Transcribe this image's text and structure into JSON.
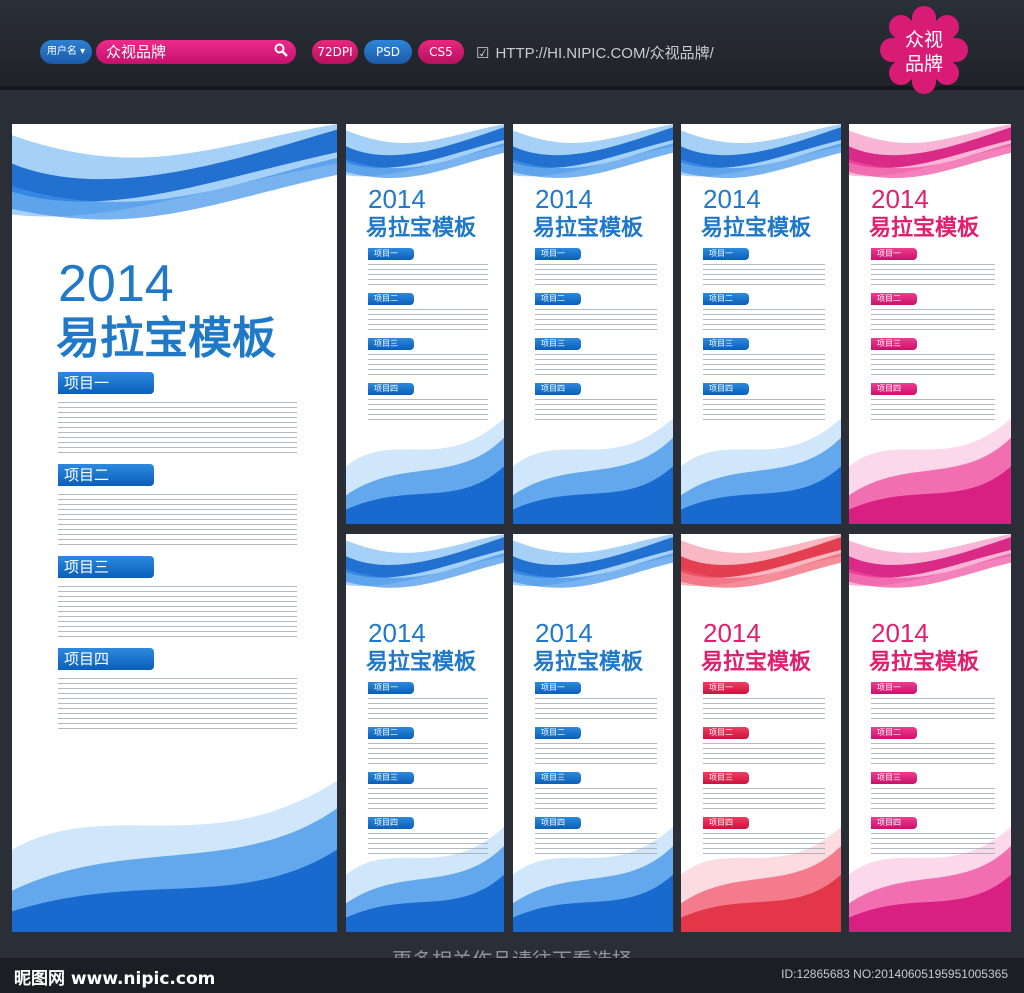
{
  "header": {
    "user_label": "用户名 ▾",
    "search_value": "众视品牌",
    "badges": [
      "72DPI",
      "PSD",
      "CS5"
    ],
    "url": "HTTP://HI.NIPIC.COM/众视品牌/",
    "logo_text": [
      "众视",
      "品牌"
    ]
  },
  "banner": {
    "year": "2014",
    "title": "易拉宝模板",
    "sections": [
      "项目一",
      "项目二",
      "项目三",
      "项目四"
    ]
  },
  "colors": {
    "blue": "#1f78c8",
    "pink": "#e0206e",
    "red": "#e8334a"
  },
  "footer": {
    "caption": "更多相关作品请往下看选择",
    "site": "昵图网 www.nipic.com",
    "meta": "ID:12865683 NO:20140605195951005365"
  }
}
